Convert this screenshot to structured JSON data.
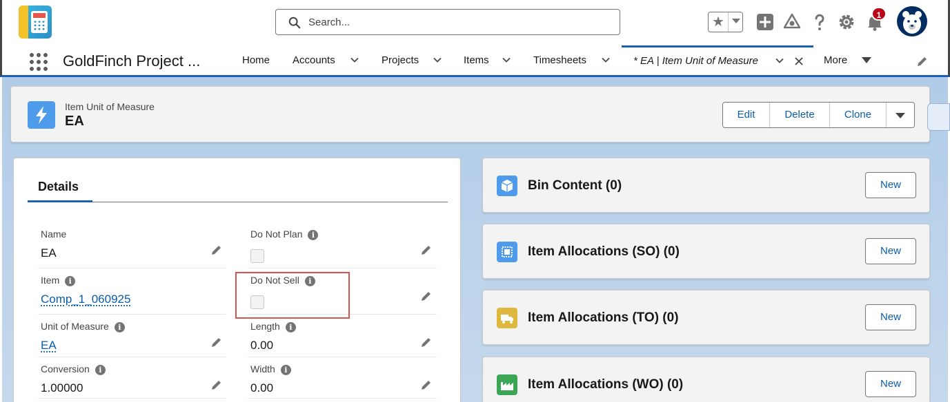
{
  "header": {
    "search_placeholder": "Search...",
    "notification_count": "1"
  },
  "nav": {
    "app_name": "GoldFinch Project ...",
    "items": [
      "Home",
      "Accounts",
      "Projects",
      "Items",
      "Timesheets"
    ],
    "active_tab": "* EA | Item Unit of Measure",
    "more": "More"
  },
  "record": {
    "type": "Item Unit of Measure",
    "name": "EA",
    "actions": [
      "Edit",
      "Delete",
      "Clone"
    ]
  },
  "details": {
    "tab": "Details",
    "fields": {
      "name": {
        "label": "Name",
        "value": "EA"
      },
      "do_not_plan": {
        "label": "Do Not Plan"
      },
      "item": {
        "label": "Item",
        "value": "Comp_1_060925"
      },
      "do_not_sell": {
        "label": "Do Not Sell"
      },
      "uom": {
        "label": "Unit of Measure",
        "value": "EA"
      },
      "length": {
        "label": "Length",
        "value": "0.00"
      },
      "conversion": {
        "label": "Conversion",
        "value": "1.00000"
      },
      "width": {
        "label": "Width",
        "value": "0.00"
      }
    }
  },
  "related": [
    {
      "title": "Bin Content (0)",
      "button": "New",
      "color": "#4d9bea"
    },
    {
      "title": "Item Allocations (SO) (0)",
      "button": "New",
      "color": "#4d9bea"
    },
    {
      "title": "Item Allocations (TO) (0)",
      "button": "New",
      "color": "#e0b73f"
    },
    {
      "title": "Item Allocations (WO) (0)",
      "button": "New",
      "color": "#3ba755"
    }
  ],
  "colors": {
    "brand": "#1b5fb5",
    "link": "#0b5cab",
    "highlight": "#d9534f"
  }
}
